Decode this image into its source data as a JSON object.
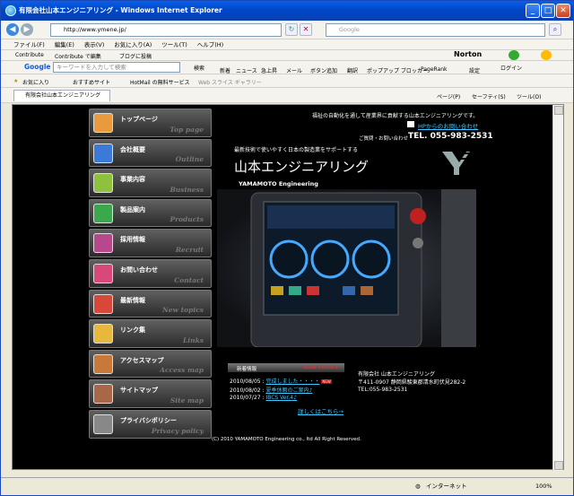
{
  "window": {
    "title": "有限会社山本エンジニアリング - Windows Internet Explorer",
    "url": "http://www.ymene.jp/",
    "search_placeholder": "Google"
  },
  "menu": [
    "ファイル(F)",
    "編集(E)",
    "表示(V)",
    "お気に入り(A)",
    "ツール(T)",
    "ヘルプ(H)"
  ],
  "contribute_bar": {
    "items": [
      "Contribute",
      "Contribute で編集",
      "ブログに投稿"
    ],
    "norton": "Norton"
  },
  "google_bar": {
    "label": "Google",
    "placeholder": "キーワードを入力して検索",
    "search_button": "検索",
    "buttons": [
      "新着",
      "ニュース",
      "急上昇",
      "メール",
      "ボタン追加",
      "翻訳",
      "ポップアップ ブロッカー",
      "PageRank",
      "設定",
      "ログイン"
    ]
  },
  "favorites_bar": {
    "label": "お気に入り",
    "items": [
      "おすすめサイト",
      "HotMail の無料サービス",
      "Web スライス ギャラリー"
    ]
  },
  "tab": {
    "title": "有限会社山本エンジニアリング"
  },
  "command_bar": [
    "ページ(P)",
    "セーフティ(S)",
    "ツール(O)"
  ],
  "site": {
    "tagline": "福祉の自動化を通して産業界に貢献する山本エンジニアリングです。",
    "contact_link": "HPからのお問い合わせ",
    "tel_label": "ご質問・お問い合わせ",
    "tel": "TEL. 055-983-2531",
    "subtitle": "最新技術で使いやすく日本の製造業をサポートする",
    "company_jp": "山本エンジニアリング",
    "company_en": "YAMAMOTO Engineering",
    "nav": [
      {
        "jp": "トップページ",
        "en": "Top page",
        "color": "#e89a3c"
      },
      {
        "jp": "会社概要",
        "en": "Outline",
        "color": "#3c7ad8"
      },
      {
        "jp": "事業内容",
        "en": "Business",
        "color": "#8fc23c"
      },
      {
        "jp": "製品案内",
        "en": "Products",
        "color": "#3ca84e"
      },
      {
        "jp": "採用情報",
        "en": "Recruit",
        "color": "#b8488c"
      },
      {
        "jp": "お問い合わせ",
        "en": "Contact",
        "color": "#d8487a"
      },
      {
        "jp": "最新情報",
        "en": "New topics",
        "color": "#d84838"
      },
      {
        "jp": "リンク集",
        "en": "Links",
        "color": "#e8b83c"
      },
      {
        "jp": "アクセスマップ",
        "en": "Access map",
        "color": "#c87838"
      },
      {
        "jp": "サイトマップ",
        "en": "Site map",
        "color": "#a86848"
      },
      {
        "jp": "プライバシポリシー",
        "en": "Privacy policy",
        "color": "#888888"
      }
    ],
    "news": {
      "header": "新着情報",
      "header_en": "NEW TOPICS",
      "items": [
        {
          "date": "2010/08/05",
          "text": "完成しました・・・・",
          "badge": "NEW"
        },
        {
          "date": "2010/08/02",
          "text": "夏季休暇のご案内♪"
        },
        {
          "date": "2010/07/27",
          "text": "IBCS Ver.4♪"
        }
      ],
      "more": "詳しくはこちら→"
    },
    "address": [
      "有限会社 山本エンジニアリング",
      "〒411-0907 静岡県駿東郡清水町伏見282-2",
      "TEL:055-983-2531"
    ],
    "copyright": "(C) 2010 YAMAMOTO Engineering co., ltd All Right Reserved."
  },
  "status_bar": {
    "zone": "インターネット",
    "zoom": "100%"
  }
}
